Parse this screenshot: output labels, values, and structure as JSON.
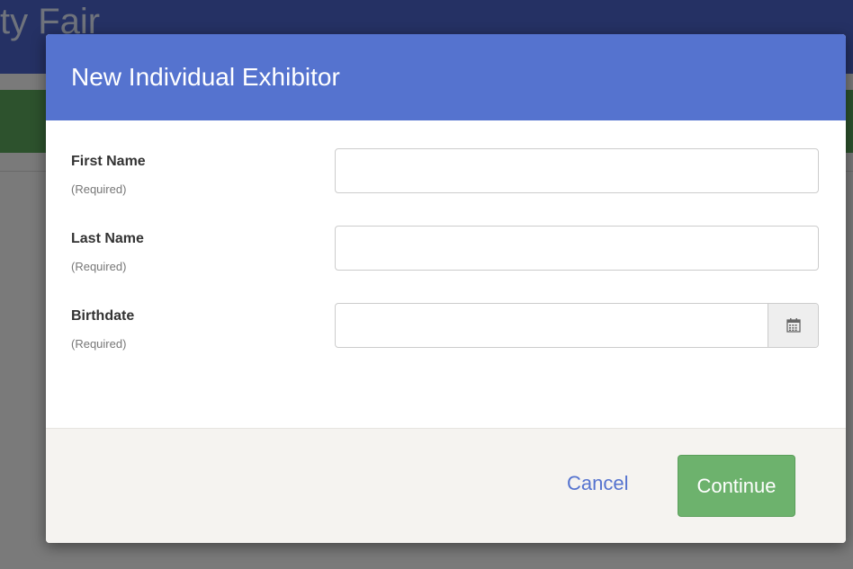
{
  "background": {
    "title_fragment": "ty Fair"
  },
  "modal": {
    "title": "New Individual Exhibitor",
    "fields": [
      {
        "label": "First Name",
        "hint": "(Required)",
        "value": ""
      },
      {
        "label": "Last Name",
        "hint": "(Required)",
        "value": ""
      },
      {
        "label": "Birthdate",
        "hint": "(Required)",
        "value": "",
        "icon": "calendar-icon"
      }
    ],
    "cancel_label": "Cancel",
    "continue_label": "Continue"
  },
  "colors": {
    "header": "#5573cf",
    "continue_button": "#6db26d",
    "cancel_link": "#5573cf",
    "footer": "#f5f3f0"
  }
}
